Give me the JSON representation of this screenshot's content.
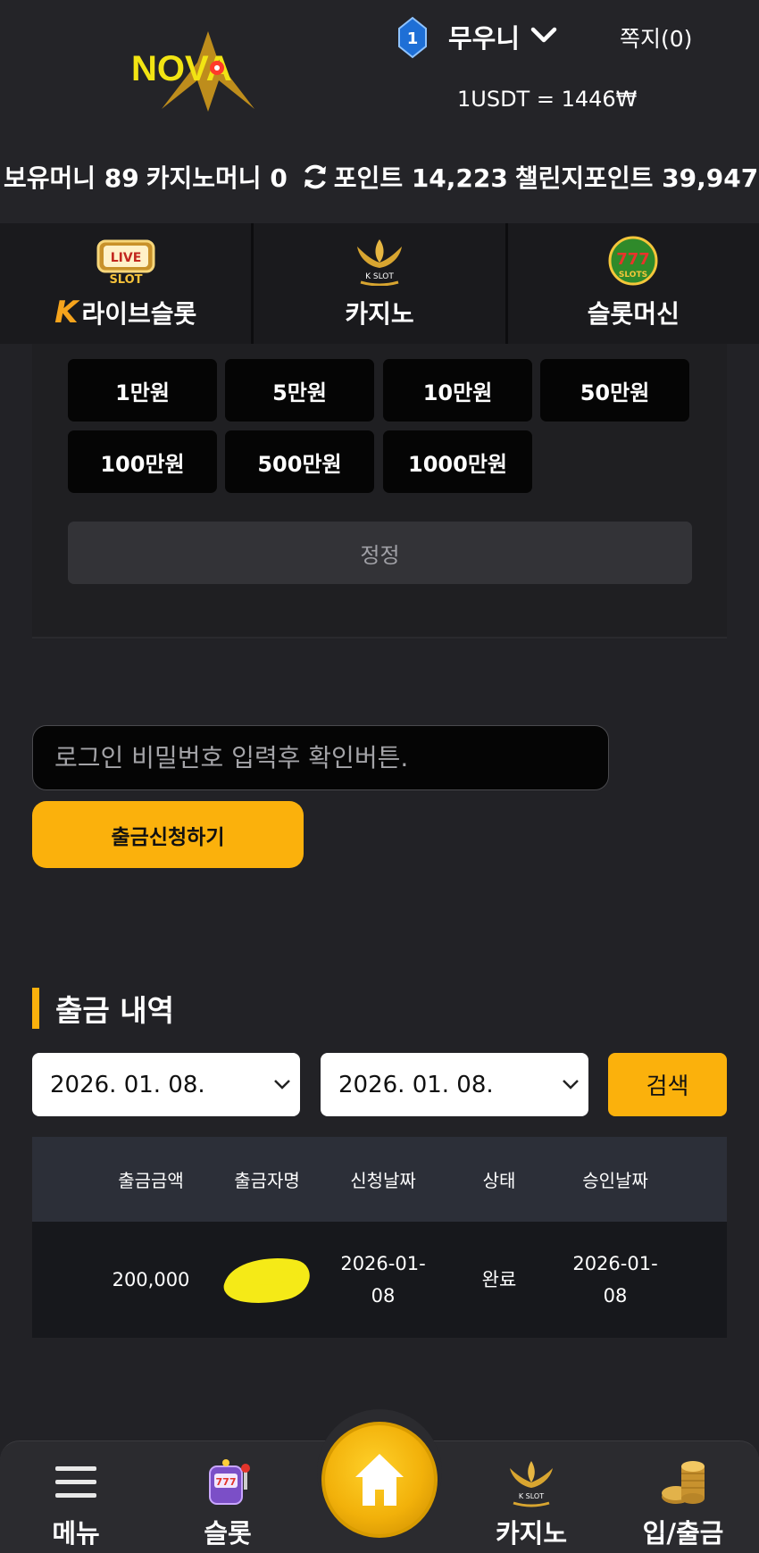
{
  "header": {
    "logo_text": "NOVA",
    "level": "1",
    "username": "무우니",
    "memo": "쪽지(0)",
    "rate": "1USDT = 1446₩"
  },
  "balances": {
    "holding_money": "보유머니 89",
    "casino_money": "카지노머니 0",
    "point": "포인트 14,223",
    "challenge_point": "챌린지포인트 39,947"
  },
  "categories": [
    {
      "label": "라이브슬롯",
      "icon": "live-slot-icon",
      "icon_text": "LIVE SLOT",
      "prefix": "K"
    },
    {
      "label": "카지노",
      "icon": "k-slot-icon",
      "icon_text": "K SLOT"
    },
    {
      "label": "슬롯머신",
      "icon": "777-slots-icon",
      "icon_text": "777 SLOTS"
    }
  ],
  "amounts": [
    "1만원",
    "5만원",
    "10만원",
    "50만원",
    "100만원",
    "500만원",
    "1000만원"
  ],
  "reset_label": "정정",
  "password_placeholder": "로그인 비밀번호 입력후 확인버튼.",
  "withdraw_button": "출금신청하기",
  "history": {
    "title": "출금 내역",
    "date_from": "2026. 01. 08.",
    "date_to": "2026. 01. 08.",
    "search_label": "검색",
    "columns": [
      "출금금액",
      "출금자명",
      "신청날짜",
      "상태",
      "승인날짜"
    ],
    "rows": [
      {
        "amount": "200,000",
        "name": "",
        "request_date": "2026-01-08",
        "status": "완료",
        "approve_date": "2026-01-08"
      }
    ]
  },
  "nav": {
    "menu": "메뉴",
    "slot": "슬롯",
    "casino": "카지노",
    "deposit": "입/출금"
  },
  "colors": {
    "accent": "#fbb10c",
    "background": "#222226",
    "panel": "#1f1f22",
    "button_dark": "#050505"
  }
}
